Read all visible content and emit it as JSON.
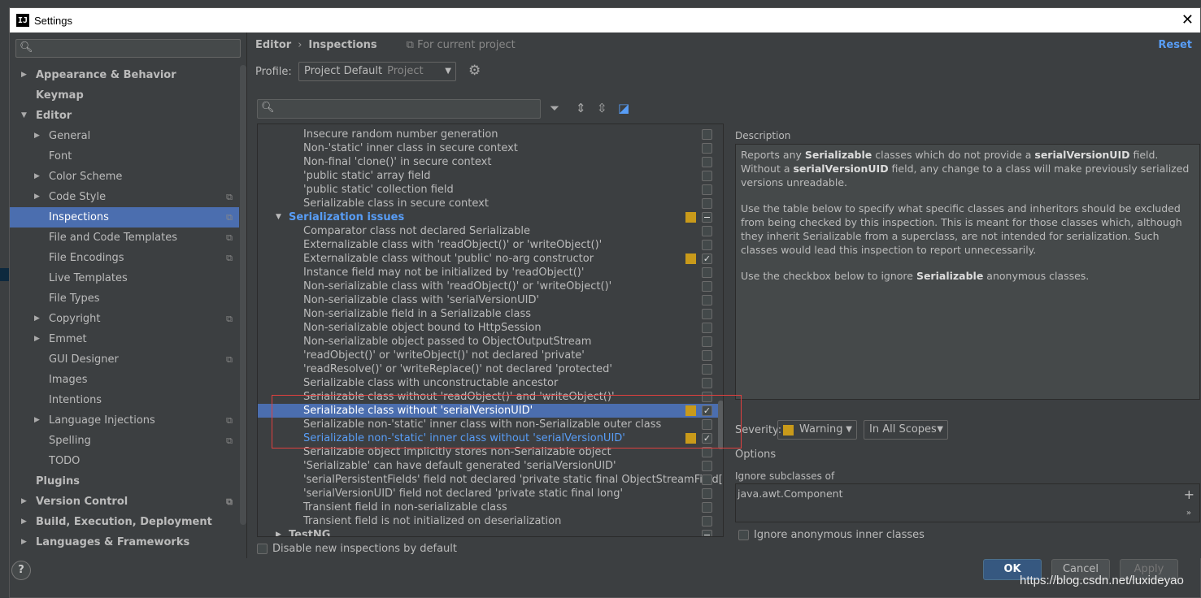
{
  "window": {
    "title": "Settings",
    "app_icon": "IJ"
  },
  "left": {
    "items": [
      {
        "label": "Appearance & Behavior",
        "level": 0,
        "arrow": "right",
        "bold": true
      },
      {
        "label": "Keymap",
        "level": 0,
        "bold": true
      },
      {
        "label": "Editor",
        "level": 0,
        "arrow": "down",
        "bold": true
      },
      {
        "label": "General",
        "level": 1,
        "arrow": "right"
      },
      {
        "label": "Font",
        "level": 1
      },
      {
        "label": "Color Scheme",
        "level": 1,
        "arrow": "right"
      },
      {
        "label": "Code Style",
        "level": 1,
        "arrow": "right",
        "project": true
      },
      {
        "label": "Inspections",
        "level": 1,
        "selected": true,
        "project": true
      },
      {
        "label": "File and Code Templates",
        "level": 1,
        "project": true
      },
      {
        "label": "File Encodings",
        "level": 1,
        "project": true
      },
      {
        "label": "Live Templates",
        "level": 1
      },
      {
        "label": "File Types",
        "level": 1
      },
      {
        "label": "Copyright",
        "level": 1,
        "arrow": "right",
        "project": true
      },
      {
        "label": "Emmet",
        "level": 1,
        "arrow": "right"
      },
      {
        "label": "GUI Designer",
        "level": 1,
        "project": true
      },
      {
        "label": "Images",
        "level": 1
      },
      {
        "label": "Intentions",
        "level": 1
      },
      {
        "label": "Language Injections",
        "level": 1,
        "arrow": "right",
        "project": true
      },
      {
        "label": "Spelling",
        "level": 1,
        "project": true
      },
      {
        "label": "TODO",
        "level": 1
      },
      {
        "label": "Plugins",
        "level": 0,
        "bold": true
      },
      {
        "label": "Version Control",
        "level": 0,
        "arrow": "right",
        "bold": true,
        "project": true
      },
      {
        "label": "Build, Execution, Deployment",
        "level": 0,
        "arrow": "right",
        "bold": true
      },
      {
        "label": "Languages & Frameworks",
        "level": 0,
        "arrow": "right",
        "bold": true
      }
    ]
  },
  "header": {
    "crumb1": "Editor",
    "crumb2": "Inspections",
    "scope": "For current project",
    "reset": "Reset",
    "profile_label": "Profile:",
    "profile_value": "Project Default",
    "profile_kind": "Project"
  },
  "inspections": [
    {
      "label": "Insecure random number generation",
      "checked": false
    },
    {
      "label": "Non-'static' inner class in secure context",
      "checked": false
    },
    {
      "label": "Non-final 'clone()' in secure context",
      "checked": false
    },
    {
      "label": "'public static' array field",
      "checked": false
    },
    {
      "label": "'public static' collection field",
      "checked": false
    },
    {
      "label": "Serializable class in secure context",
      "checked": false
    },
    {
      "label": "Serialization issues",
      "group": true,
      "open": true,
      "severity": true,
      "state": "mixed"
    },
    {
      "label": "Comparator class not declared Serializable",
      "checked": false
    },
    {
      "label": "Externalizable class with 'readObject()' or 'writeObject()'",
      "checked": false
    },
    {
      "label": "Externalizable class without 'public' no-arg constructor",
      "checked": true,
      "severity": true
    },
    {
      "label": "Instance field may not be initialized by 'readObject()'",
      "checked": false
    },
    {
      "label": "Non-serializable class with 'readObject()' or 'writeObject()'",
      "checked": false
    },
    {
      "label": "Non-serializable class with 'serialVersionUID'",
      "checked": false
    },
    {
      "label": "Non-serializable field in a Serializable class",
      "checked": false
    },
    {
      "label": "Non-serializable object bound to HttpSession",
      "checked": false
    },
    {
      "label": "Non-serializable object passed to ObjectOutputStream",
      "checked": false
    },
    {
      "label": "'readObject()' or 'writeObject()' not declared 'private'",
      "checked": false
    },
    {
      "label": "'readResolve()' or 'writeReplace()' not declared 'protected'",
      "checked": false
    },
    {
      "label": "Serializable class with unconstructable ancestor",
      "checked": false
    },
    {
      "label": "Serializable class without 'readObject()' and 'writeObject()'",
      "checked": false
    },
    {
      "label": "Serializable class without 'serialVersionUID'",
      "checked": true,
      "severity": true,
      "selected": true
    },
    {
      "label": "Serializable non-'static' inner class with non-Serializable outer class",
      "checked": false
    },
    {
      "label": "Serializable non-'static' inner class without 'serialVersionUID'",
      "checked": true,
      "severity": true,
      "blue": true
    },
    {
      "label": "Serializable object implicitly stores non-Serializable object",
      "checked": false
    },
    {
      "label": "'Serializable' can have default generated 'serialVersionUID'",
      "checked": false
    },
    {
      "label": "'serialPersistentFields' field not declared 'private static final ObjectStreamField[]'",
      "checked": false
    },
    {
      "label": "'serialVersionUID' field not declared 'private static final long'",
      "checked": false
    },
    {
      "label": "Transient field in non-serializable class",
      "checked": false
    },
    {
      "label": "Transient field is not initialized on deserialization",
      "checked": false
    },
    {
      "label": "TestNG",
      "group2": true,
      "state": "mixed"
    }
  ],
  "disable_new": "Disable new inspections by default",
  "description": {
    "label": "Description",
    "p1_a": "Reports any ",
    "p1_b": "Serializable",
    "p1_c": " classes which do not provide a ",
    "p1_d": "serialVersionUID",
    "p1_e": " field. Without a ",
    "p1_f": "serialVersionUID",
    "p1_g": " field, any change to a class will make previously serialized versions unreadable.",
    "p2": "Use the table below to specify what specific classes and inheritors should be excluded from being checked by this inspection. This is meant for those classes which, although they inherit Serializable from a superclass, are not intended for serialization. Such classes would lead this inspection to report unnecessarily.",
    "p3_a": "Use the checkbox below to ignore ",
    "p3_b": "Serializable",
    "p3_c": " anonymous classes."
  },
  "severity": {
    "label": "Severity:",
    "value": "Warning",
    "scope": "In All Scopes"
  },
  "options": {
    "label": "Options",
    "ignore_label": "Ignore subclasses of",
    "ignore_item": "java.awt.Component",
    "anon_label": "Ignore anonymous inner classes"
  },
  "buttons": {
    "ok": "OK",
    "cancel": "Cancel",
    "apply": "Apply",
    "help": "?"
  },
  "watermark": "https://blog.csdn.net/luxideyao",
  "colors": {
    "accent": "#589df6",
    "selection": "#4b6eaf",
    "warning": "#c99a1a",
    "highlight_box": "#e0403f"
  }
}
